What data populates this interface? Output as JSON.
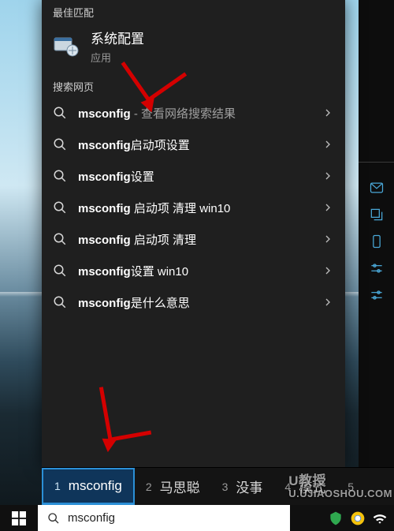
{
  "sections": {
    "best_match_header": "最佳匹配",
    "web_search_header": "搜索网页"
  },
  "best_match": {
    "title": "系统配置",
    "subtitle": "应用"
  },
  "web_results": [
    {
      "bold": "msconfig",
      "rest": "",
      "suffix": " - 查看网络搜索结果"
    },
    {
      "bold": "msconfig",
      "rest": "启动项设置",
      "suffix": ""
    },
    {
      "bold": "msconfig",
      "rest": "设置",
      "suffix": ""
    },
    {
      "bold": "msconfig",
      "rest": " 启动项 清理 win10",
      "suffix": ""
    },
    {
      "bold": "msconfig",
      "rest": " 启动项 清理",
      "suffix": ""
    },
    {
      "bold": "msconfig",
      "rest": "设置 win10",
      "suffix": ""
    },
    {
      "bold": "msconfig",
      "rest": "是什么意思",
      "suffix": ""
    }
  ],
  "ime": {
    "candidates": [
      {
        "num": "1",
        "text": "msconfig"
      },
      {
        "num": "2",
        "text": "马思聪"
      },
      {
        "num": "3",
        "text": "没事"
      },
      {
        "num": "4",
        "text": "模式"
      },
      {
        "num": "5",
        "text": ""
      }
    ]
  },
  "searchbox": {
    "value": "msconfig"
  },
  "watermark": {
    "line1": "U教授",
    "line2": "U.UJIAOSHOU.COM"
  }
}
